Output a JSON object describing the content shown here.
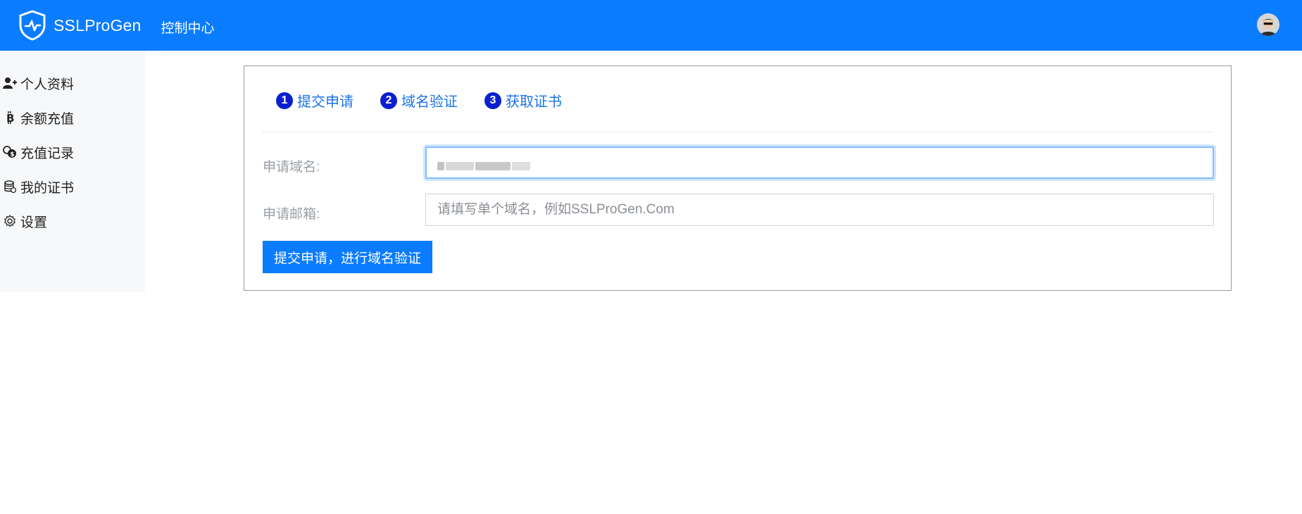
{
  "app": {
    "brand": "SSLProGen",
    "nav_link": "控制中心"
  },
  "colors": {
    "topbar": "#0a7cff",
    "sidebar_bg": "#f7f8fa",
    "step_badge": "#0b1fcf",
    "step_text": "#1a73e8",
    "primary_button": "#0a7cff"
  },
  "icons": {
    "brand_logo": "shield-pulse-icon",
    "avatar": "user-avatar"
  },
  "sidebar": {
    "items": [
      {
        "label": "个人资料",
        "icon": "user-plus-icon"
      },
      {
        "label": "余额充值",
        "icon": "bitcoin-icon"
      },
      {
        "label": "充值记录",
        "icon": "coins-icon"
      },
      {
        "label": "我的证书",
        "icon": "database-icon"
      },
      {
        "label": "设置",
        "icon": "gear-icon"
      }
    ]
  },
  "steps": [
    {
      "num": "1",
      "label": "提交申请"
    },
    {
      "num": "2",
      "label": "域名验证"
    },
    {
      "num": "3",
      "label": "获取证书"
    }
  ],
  "form": {
    "domain_label": "申请域名:",
    "domain_value": "",
    "email_label": "申请邮箱:",
    "email_placeholder": "请填写单个域名，例如SSLProGen.Com",
    "submit_label": "提交申请，进行域名验证"
  }
}
